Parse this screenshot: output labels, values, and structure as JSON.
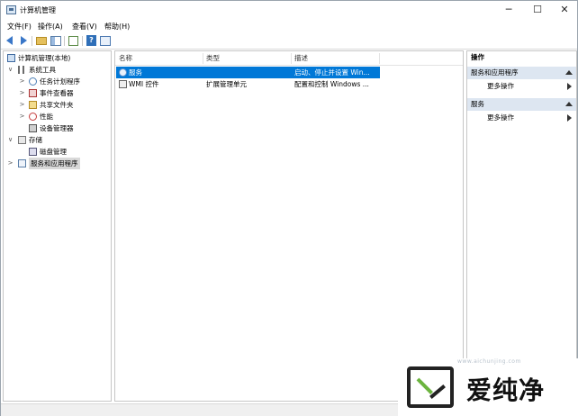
{
  "window": {
    "title": "计算机管理",
    "controls": {
      "minimize": "─",
      "maximize": "☐",
      "close": "✕"
    }
  },
  "menubar": {
    "items": [
      "文件(F)",
      "操作(A)",
      "查看(V)",
      "帮助(H)"
    ]
  },
  "toolbar": {
    "icons": [
      "back-arrow-icon",
      "forward-arrow-icon",
      "folder-up-icon",
      "show-tree-icon",
      "export-list-icon",
      "help-icon",
      "properties-icon"
    ]
  },
  "tree": {
    "root": "计算机管理(本地)",
    "items": [
      {
        "label": "系统工具",
        "expander": "∨"
      },
      {
        "label": "任务计划程序",
        "expander": ">"
      },
      {
        "label": "事件查看器",
        "expander": ">"
      },
      {
        "label": "共享文件夹",
        "expander": ">"
      },
      {
        "label": "性能",
        "expander": ">"
      },
      {
        "label": "设备管理器",
        "expander": ""
      },
      {
        "label": "存储",
        "expander": "∨"
      },
      {
        "label": "磁盘管理",
        "expander": ""
      },
      {
        "label": "服务和应用程序",
        "expander": ">"
      }
    ],
    "root_expander": "∨"
  },
  "list": {
    "columns": [
      "名称",
      "类型",
      "描述"
    ],
    "rows": [
      {
        "name": "服务",
        "type": "",
        "description": "启动、停止并设置 Win..."
      },
      {
        "name": "WMI 控件",
        "type": "扩展管理单元",
        "description": "配置和控制 Windows ..."
      }
    ]
  },
  "actions": {
    "title": "操作",
    "groups": [
      {
        "label": "服务和应用程序",
        "item": "更多操作"
      },
      {
        "label": "服务",
        "item": "更多操作"
      }
    ]
  },
  "watermark": {
    "brand": "爱纯净",
    "url": "www.aichunjing.com"
  },
  "colors": {
    "selection": "#0078d7",
    "group_header": "#dde6f1",
    "tree_selection": "#d9d9d9",
    "logo_accent": "#6cb43f"
  }
}
